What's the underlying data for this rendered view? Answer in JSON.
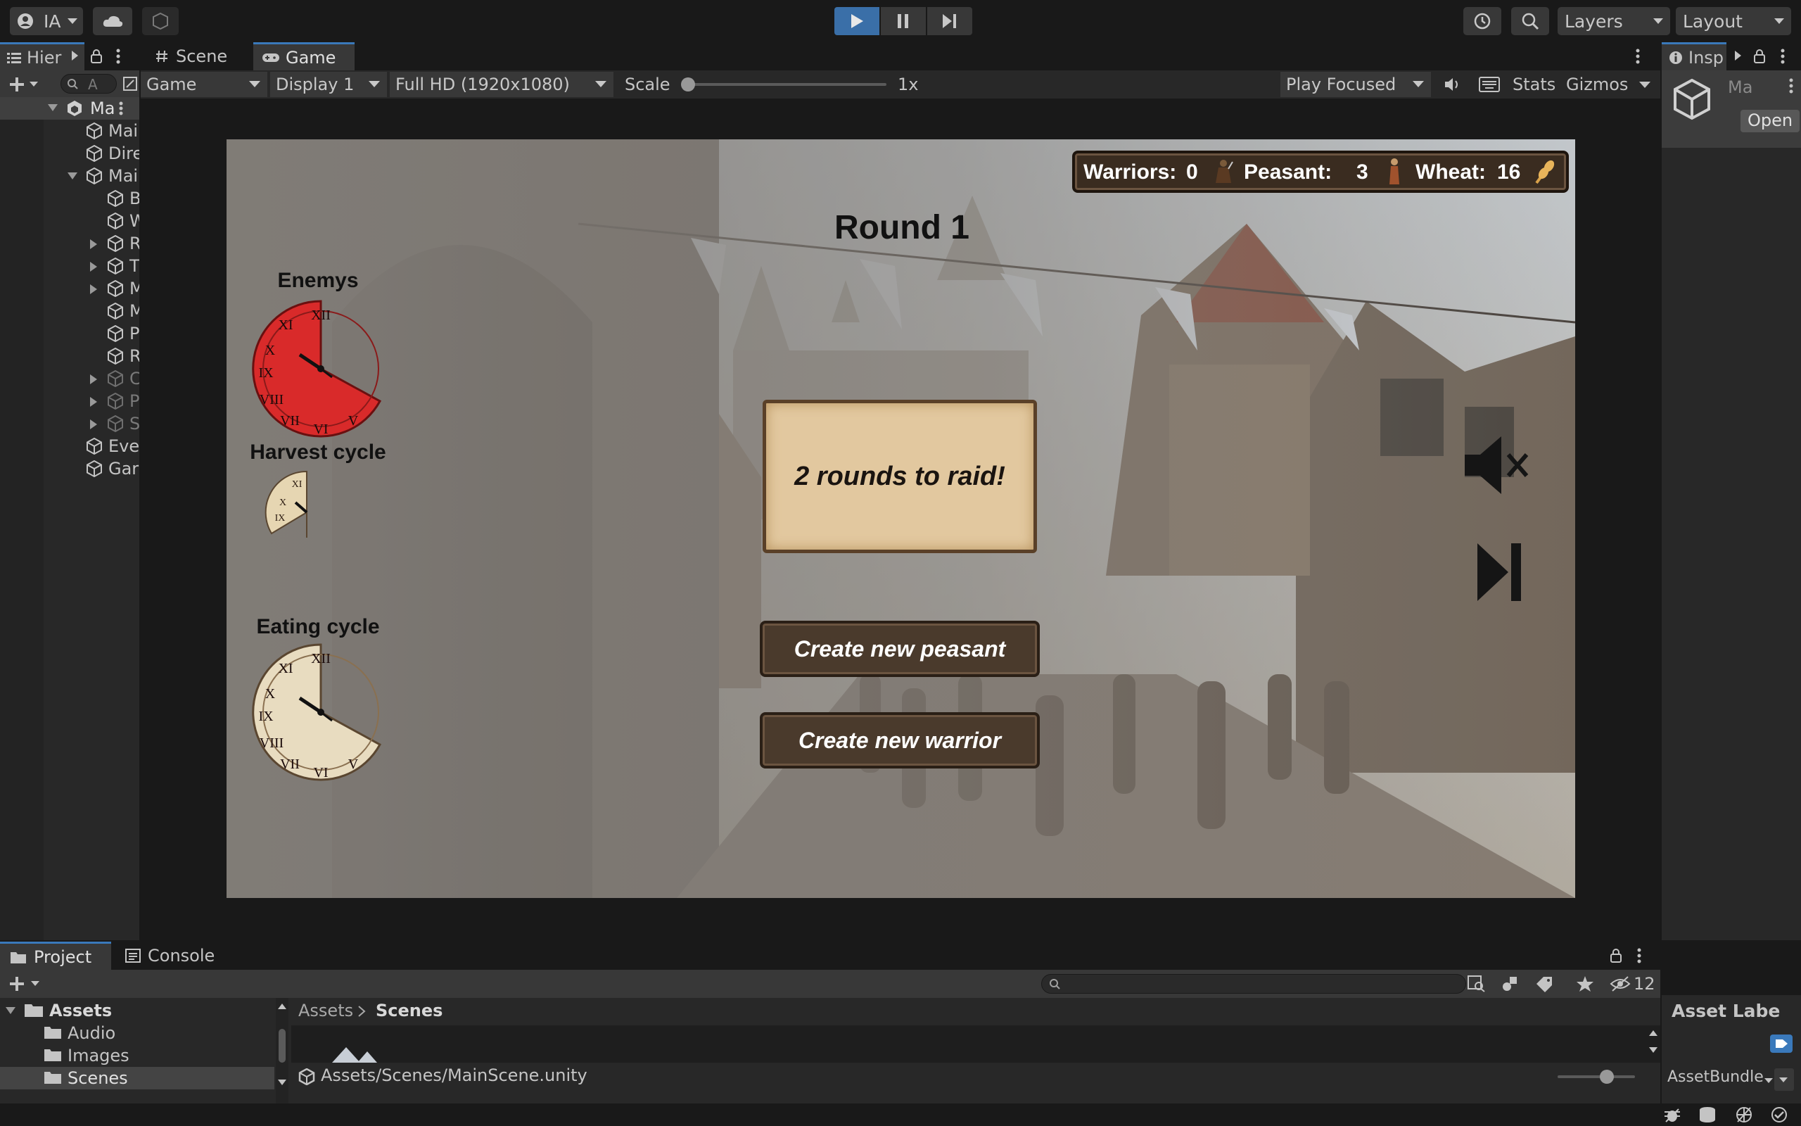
{
  "toolbar": {
    "account_label": "IA",
    "layers_label": "Layers",
    "layout_label": "Layout"
  },
  "hierarchy": {
    "tab_label": "Hier",
    "search_placeholder": "A",
    "root_label": "Ma",
    "items": [
      {
        "label": "Mai"
      },
      {
        "label": "Dire"
      },
      {
        "label": "Mai"
      },
      {
        "label": "B"
      },
      {
        "label": "W"
      },
      {
        "label": "R"
      },
      {
        "label": "T"
      },
      {
        "label": "M"
      },
      {
        "label": "M"
      },
      {
        "label": "P"
      },
      {
        "label": "R"
      },
      {
        "label": "C"
      },
      {
        "label": "P"
      },
      {
        "label": "S"
      },
      {
        "label": "Eve"
      },
      {
        "label": "Gar"
      }
    ]
  },
  "center_tabs": {
    "scene_label": "Scene",
    "game_label": "Game"
  },
  "game_toolbar": {
    "mode": "Game",
    "display": "Display 1",
    "resolution": "Full HD (1920x1080)",
    "scale_label": "Scale",
    "scale_value": "1x",
    "scale_level": 0,
    "play_focused": "Play Focused",
    "stats_label": "Stats",
    "gizmos_label": "Gizmos"
  },
  "inspector": {
    "tab_label": "Insp",
    "object_name": "Ma",
    "open_button": "Open",
    "asset_labels": "Asset Labe",
    "asset_bundle": "AssetBundle"
  },
  "game": {
    "resources": {
      "warriors_label": "Warriors:",
      "warriors_value": "0",
      "peasant_label": "Peasant:",
      "peasant_value": "3",
      "wheat_label": "Wheat:",
      "wheat_value": "16"
    },
    "round_title": "Round 1",
    "enemys_label": "Enemys",
    "harvest_label": "Harvest cycle",
    "eating_label": "Eating cycle",
    "raid_message": "2 rounds to raid!",
    "create_peasant": "Create new peasant",
    "create_warrior": "Create new warrior",
    "colors": {
      "enemy_clock": "#d92a2a",
      "parchment": "#e2c89f",
      "button_wood": "#4a3a2c"
    }
  },
  "bottom": {
    "project_tab": "Project",
    "console_tab": "Console",
    "hidden_count": "12",
    "tree": [
      {
        "label": "Assets"
      },
      {
        "label": "Audio"
      },
      {
        "label": "Images"
      },
      {
        "label": "Scenes"
      }
    ],
    "breadcrumb_root": "Assets",
    "breadcrumb_current": "Scenes",
    "selected_path": "Assets/Scenes/MainScene.unity"
  }
}
